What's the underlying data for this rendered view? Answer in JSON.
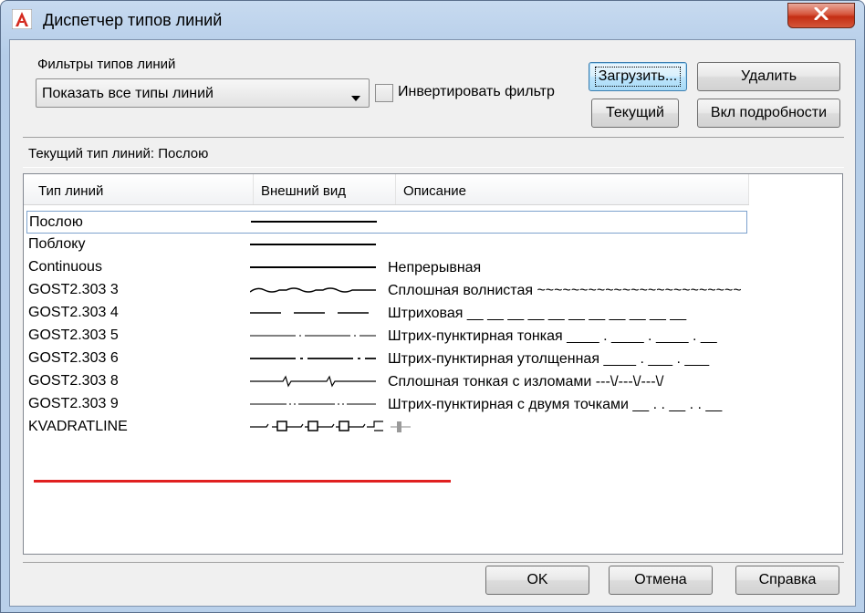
{
  "window": {
    "title": "Диспетчер типов линий"
  },
  "filters": {
    "label": "Фильтры типов линий",
    "selected": "Показать все типы линий",
    "invert_label": "Инвертировать фильтр",
    "invert_checked": false
  },
  "buttons": {
    "load": "Загрузить...",
    "delete": "Удалить",
    "current": "Текущий",
    "details": "Вкл подробности",
    "ok": "OK",
    "cancel": "Отмена",
    "help": "Справка"
  },
  "current_linetype": "Текущий тип линий:  Послою",
  "list": {
    "columns": [
      "Тип линий",
      "Внешний вид",
      "Описание"
    ],
    "rows": [
      {
        "name": "Послою",
        "description": "",
        "pattern": "solid"
      },
      {
        "name": "Поблоку",
        "description": "",
        "pattern": "solid"
      },
      {
        "name": "Continuous",
        "description": "Непрерывная",
        "pattern": "solid"
      },
      {
        "name": "GOST2.303 3",
        "description": "Сплошная волнистая ~~~~~~~~~~~~~~~~~~~~~~~~",
        "pattern": "wavy"
      },
      {
        "name": "GOST2.303 4",
        "description": "Штриховая __ __ __ __ __ __ __ __ __ __ __",
        "pattern": "dashed"
      },
      {
        "name": "GOST2.303 5",
        "description": "Штрих-пунктирная тонкая ____ . ____ . ____ . __",
        "pattern": "dashdot"
      },
      {
        "name": "GOST2.303 6",
        "description": "Штрих-пунктирная утолщенная ____ . ___ . ___",
        "pattern": "dashdot-thick"
      },
      {
        "name": "GOST2.303 8",
        "description": "Сплошная тонкая с изломами ---\\/---\\/---\\/",
        "pattern": "zigzag"
      },
      {
        "name": "GOST2.303 9",
        "description": "Штрих-пунктирная с двумя точками __ . . __ . . __",
        "pattern": "dashdotdot"
      },
      {
        "name": "KVADRATLINE",
        "description": "",
        "pattern": "squares"
      }
    ]
  },
  "colors": {
    "highlight": "#e02020",
    "title_bg": "#c7daf0"
  },
  "icons": {
    "app": "autocad-logo-icon",
    "close": "close-icon",
    "dropdown": "chevron-down-icon"
  }
}
